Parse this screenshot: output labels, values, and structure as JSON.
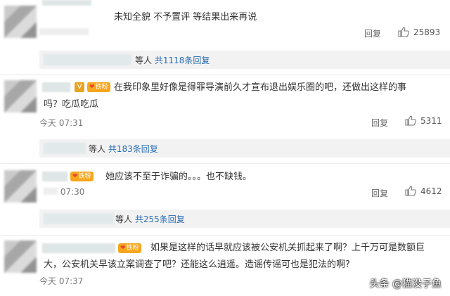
{
  "comments": [
    {
      "text": "未知全貌 不予置评 等结果出来再说",
      "time": "",
      "reply_label": "回复",
      "likes": "25893"
    },
    {
      "text_line1": "在我印象里好像是得罪导演前久才宣布退出娱乐圈的吧，还做出这样的事",
      "text_line2": "吗？吃瓜吃瓜",
      "time": "今天 07:31",
      "reply_label": "回复",
      "likes": "5311",
      "fan_badge": "铁粉"
    },
    {
      "text": "她应该不至于诈骗的。。。也不缺钱。",
      "time": "07:30",
      "reply_label": "回复",
      "likes": "4612",
      "fan_badge": "铁粉"
    },
    {
      "text_line1": "如果是这样的话早就应该被公安机关抓起来了啊？上千万可是数额巨",
      "text_line2": "大，公安机关早该立案调查了吧？还能这么逍遥。造谣传谣可也是犯法的啊?",
      "time": "今天 07:37",
      "fan_badge": "铁粉"
    }
  ],
  "sub_replies": [
    {
      "prefix": "等人",
      "count_text": "共1118条回复"
    },
    {
      "prefix": "等人",
      "count_text": "共183条回复"
    },
    {
      "prefix": "等人",
      "count_text": "共255条回复"
    }
  ],
  "watermark": "头条 @猫没子鱼"
}
